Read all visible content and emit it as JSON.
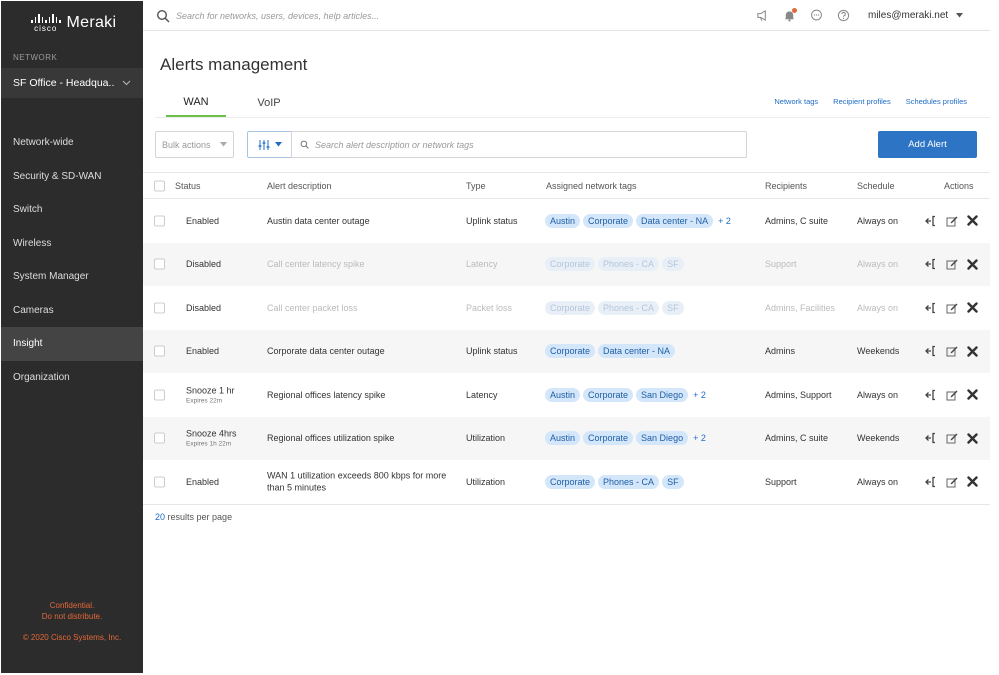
{
  "brand": {
    "cisco": "cisco",
    "product": "Meraki"
  },
  "sidebar": {
    "network_label": "NETWORK",
    "network_name": "SF Office - Headqua..",
    "items": [
      {
        "label": "Network-wide"
      },
      {
        "label": "Security & SD-WAN"
      },
      {
        "label": "Switch"
      },
      {
        "label": "Wireless"
      },
      {
        "label": "System Manager"
      },
      {
        "label": "Cameras"
      },
      {
        "label": "Insight"
      },
      {
        "label": "Organization"
      }
    ],
    "active": "Insight",
    "footer": {
      "line1": "Confidential.",
      "line2": "Do not distribute.",
      "copyright": "© 2020 Cisco Systems, Inc."
    }
  },
  "topbar": {
    "search_placeholder": "Search for networks, users, devices, help articles...",
    "user": "miles@meraki.net"
  },
  "page": {
    "title": "Alerts management",
    "tabs": [
      {
        "label": "WAN"
      },
      {
        "label": "VoIP"
      }
    ],
    "active_tab": "WAN",
    "links": [
      {
        "label": "Network tags"
      },
      {
        "label": "Recipient profiles"
      },
      {
        "label": "Schedules profiles"
      }
    ]
  },
  "toolbar": {
    "bulk_actions": "Bulk actions",
    "search_placeholder": "Search alert description or network tags",
    "add_alert": "Add Alert"
  },
  "table": {
    "headers": {
      "status": "Status",
      "description": "Alert description",
      "type": "Type",
      "tags": "Assigned network tags",
      "recipients": "Recipients",
      "schedule": "Schedule",
      "actions": "Actions"
    },
    "rows": [
      {
        "status": "Enabled",
        "status_sub": "",
        "description": "Austin data center outage",
        "type": "Uplink status",
        "tags": [
          "Austin",
          "Corporate",
          "Data center - NA"
        ],
        "more": "+ 2",
        "recipients": "Admins, C suite",
        "schedule": "Always on"
      },
      {
        "status": "Disabled",
        "status_sub": "",
        "description": "Call center latency spike",
        "type": "Latency",
        "tags": [
          "Corporate",
          "Phones - CA",
          "SF"
        ],
        "more": "",
        "recipients": "Support",
        "schedule": "Always on"
      },
      {
        "status": "Disabled",
        "status_sub": "",
        "description": "Call center packet loss",
        "type": "Packet loss",
        "tags": [
          "Corporate",
          "Phones - CA",
          "SF"
        ],
        "more": "",
        "recipients": "Admins, Facilities",
        "schedule": "Always on"
      },
      {
        "status": "Enabled",
        "status_sub": "",
        "description": "Corporate data center outage",
        "type": "Uplink status",
        "tags": [
          "Corporate",
          "Data center - NA"
        ],
        "more": "",
        "recipients": "Admins",
        "schedule": "Weekends"
      },
      {
        "status": "Snooze 1 hr",
        "status_sub": "Expires 22m",
        "description": "Regional offices latency spike",
        "type": "Latency",
        "tags": [
          "Austin",
          "Corporate",
          "San Diego"
        ],
        "more": "+ 2",
        "recipients": "Admins, Support",
        "schedule": "Always on"
      },
      {
        "status": "Snooze 4hrs",
        "status_sub": "Expires 1h 22m",
        "description": "Regional offices utilization spike",
        "type": "Utilization",
        "tags": [
          "Austin",
          "Corporate",
          "San Diego"
        ],
        "more": "+ 2",
        "recipients": "Admins, C suite",
        "schedule": "Weekends"
      },
      {
        "status": "Enabled",
        "status_sub": "",
        "description": "WAN 1 utilization exceeds 800 kbps for more than 5 minutes",
        "type": "Utilization",
        "tags": [
          "Corporate",
          "Phones - CA",
          "SF"
        ],
        "more": "",
        "recipients": "Support",
        "schedule": "Always on"
      }
    ]
  },
  "footer": {
    "results_count": "20",
    "results_label": "results per page"
  },
  "colors": {
    "sidebar_bg": "#2c2c2c",
    "accent_green": "#6cc04a",
    "primary_blue": "#2d74c4",
    "tag_bg": "#d3e6fa",
    "footer_orange": "#e4683a"
  }
}
